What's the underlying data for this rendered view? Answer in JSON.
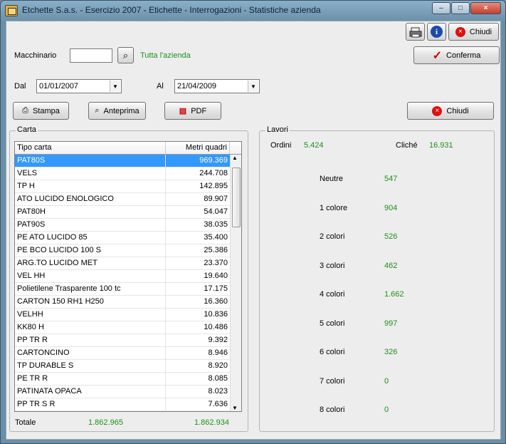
{
  "window": {
    "title": "Etchette S.a.s. - Esercizio 2007 - Etichette - Interrogazioni - Statistiche azienda",
    "min_symbol": "–",
    "max_symbol": "□",
    "close_symbol": "×"
  },
  "topbar": {
    "close_label": "Chiudi",
    "confirm_label": "Conferma"
  },
  "filters": {
    "machine_label": "Macchinario",
    "machine_value": "",
    "all_company": "Tutta l'azienda",
    "from_label": "Dal",
    "from_value": "01/01/2007",
    "to_label": "Al",
    "to_value": "21/04/2009"
  },
  "actions": {
    "print": "Stampa",
    "preview": "Anteprima",
    "pdf": "PDF",
    "close": "Chiudi"
  },
  "carta": {
    "label": "Carta",
    "columns": [
      "Tipo carta",
      "Metri quadri"
    ],
    "rows": [
      [
        "PAT80S",
        "969.369"
      ],
      [
        "VELS",
        "244.708"
      ],
      [
        "TP H",
        "142.895"
      ],
      [
        "ATO LUCIDO ENOLOGICO",
        "89.907"
      ],
      [
        "PAT80H",
        "54.047"
      ],
      [
        "PAT90S",
        "38.035"
      ],
      [
        "PE ATO LUCIDO 85",
        "35.400"
      ],
      [
        "PE BCO LUCIDO 100 S",
        "25.386"
      ],
      [
        "ARG.TO LUCIDO MET",
        "23.370"
      ],
      [
        "VEL HH",
        "19.640"
      ],
      [
        "Polietilene Trasparente 100 tc",
        "17.175"
      ],
      [
        "CARTON 150 RH1 H250",
        "16.360"
      ],
      [
        "VELHH",
        "10.836"
      ],
      [
        "KK80 H",
        "10.486"
      ],
      [
        "PP TR R",
        "9.392"
      ],
      [
        "CARTONCINO",
        "8.946"
      ],
      [
        "TP DURABLE S",
        "8.920"
      ],
      [
        "PE TR R",
        "8.085"
      ],
      [
        "PATINATA OPACA",
        "8.023"
      ],
      [
        "PP TR S R",
        "7.636"
      ]
    ],
    "total_label": "Totale",
    "total_1": "1.862.965",
    "total_2": "1.862.934"
  },
  "lavori": {
    "label": "Lavori",
    "ordini_label": "Ordini",
    "ordini_value": "5.424",
    "cliche_label": "Cliché",
    "cliche_value": "16.931",
    "stats": [
      [
        "Neutre",
        "547"
      ],
      [
        "1 colore",
        "904"
      ],
      [
        "2 colori",
        "526"
      ],
      [
        "3 colori",
        "462"
      ],
      [
        "4 colori",
        "1.662"
      ],
      [
        "5 colori",
        "997"
      ],
      [
        "6 colori",
        "326"
      ],
      [
        "7 colori",
        "0"
      ],
      [
        "8 colori",
        "0"
      ]
    ]
  },
  "colors": {
    "accent": "#1f8f1f",
    "selection": "#3399ff"
  }
}
